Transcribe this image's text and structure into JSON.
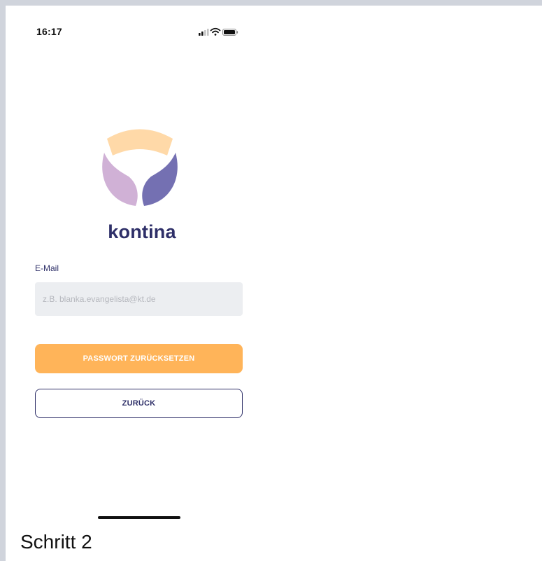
{
  "status_bar": {
    "time": "16:17",
    "icons": [
      "cellular-signal-icon",
      "wifi-icon",
      "battery-icon"
    ]
  },
  "brand": {
    "logo_icon": "kontina-logo-icon",
    "name": "kontina"
  },
  "form": {
    "email_label": "E-Mail",
    "email_placeholder": "z.B. blanka.evangelista@kt.de",
    "email_value": ""
  },
  "actions": {
    "reset_label": "PASSWORT ZURÜCKSETZEN",
    "back_label": "ZURÜCK"
  },
  "caption": "Schritt 2",
  "colors": {
    "brand_navy": "#2e2f68",
    "accent_orange": "#ffb459",
    "logo_peach": "#ffd9a8",
    "logo_lilac": "#d0b1d6",
    "logo_purple": "#7470b2",
    "input_bg": "#eceef1"
  }
}
